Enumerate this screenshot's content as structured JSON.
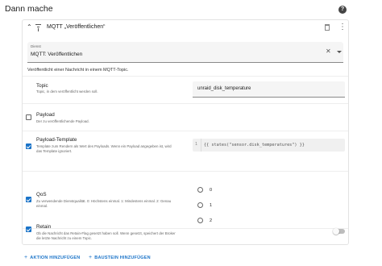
{
  "section": {
    "title": "Dann mache",
    "help_icon": "help-circle-icon"
  },
  "action": {
    "title": "MQTT „Veröffentlichen“",
    "icons": {
      "collapse": "chevron-up-icon",
      "type": "mqtt-icon",
      "delete": "trash-icon",
      "menu": "kebab-menu-icon"
    },
    "service_select": {
      "label": "Dienst",
      "value": "MQTT: Veröffentlichen",
      "clear_icon": "close-icon",
      "dropdown_icon": "caret-down-icon"
    },
    "description": "Veröffentlicht einer Nachricht in einem MQTT-Topic."
  },
  "fields": {
    "topic": {
      "title": "Topic",
      "description": "Topic, in dem veröffentlicht werden soll.",
      "value": "unraid_disk_temperature"
    },
    "payload": {
      "title": "Payload",
      "description": "Der zu veröffentlichende Payload.",
      "checked": false
    },
    "payload_template": {
      "title": "Payload-Template",
      "description_line1": "Template zum Rendern als Wert des Payloads. Wenn ein Payload angegeben ist, wird",
      "description_line2": "das Template ignoriert.",
      "checked": true,
      "line_number": "1",
      "code": "{{ states(\"sensor.disk_temperatures\") }}"
    },
    "qos": {
      "title": "QoS",
      "description_line1": "Zu verwendende Dienstqualität. 0: Höchstens einmal. 1: Mindestens einmal. 2: Genau",
      "description_line2": "einmal.",
      "checked": true,
      "options": [
        "0",
        "1",
        "2"
      ],
      "selected": null
    },
    "retain": {
      "title": "Retain",
      "description_line1": "Ob die Nachricht das Retain-Flag gesetzt haben soll. Wenn gesetzt, speichert der Broker",
      "description_line2": "die letzte Nachricht zu einem Topic.",
      "checked": true,
      "toggle_on": false
    }
  },
  "footer": {
    "add_action": "AKTION HINZUFÜGEN",
    "add_block": "BAUSTEIN HINZUFÜGEN"
  },
  "colors": {
    "accent": "#1a73c8",
    "field_bg": "#f5f5f5",
    "border": "#e3e3e3"
  }
}
